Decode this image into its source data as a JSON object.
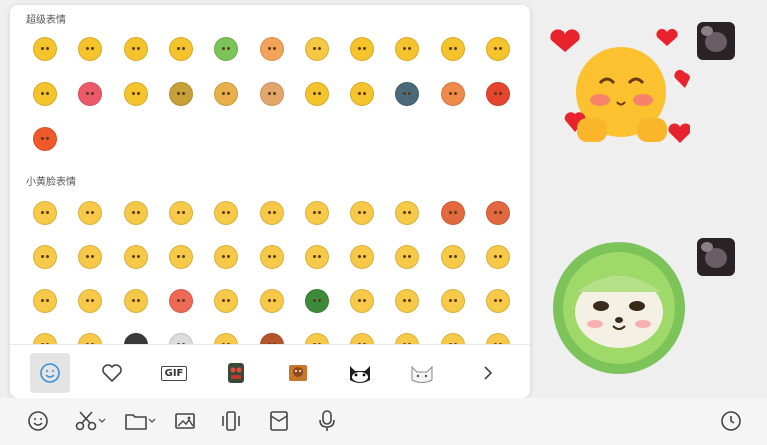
{
  "emoji_panel": {
    "sections": [
      {
        "title": "超级表情",
        "emojis": [
          {
            "name": "crying-face",
            "color": "#f5c32c"
          },
          {
            "name": "crying-laughing-face",
            "color": "#f5c32c"
          },
          {
            "name": "blushing-face",
            "color": "#f5c32c"
          },
          {
            "name": "sunglasses-face",
            "color": "#f5c32c"
          },
          {
            "name": "cabbage-dog",
            "color": "#7cc35a"
          },
          {
            "name": "eyes-pleading-face",
            "color": "#f3a35a"
          },
          {
            "name": "yellow-chick",
            "color": "#f7c844"
          },
          {
            "name": "party-face",
            "color": "#f5c32c"
          },
          {
            "name": "tongue-face",
            "color": "#f5c32c"
          },
          {
            "name": "screaming-face",
            "color": "#f5c32c"
          },
          {
            "name": "party-hat-face",
            "color": "#f5c32c"
          },
          {
            "name": "drooling-face",
            "color": "#f5c32c"
          },
          {
            "name": "kiss-face",
            "color": "#ec5a6a"
          },
          {
            "name": "peeking-face",
            "color": "#f5c32c"
          },
          {
            "name": "sunflower-face",
            "color": "#c7a03a"
          },
          {
            "name": "box-face",
            "color": "#e8b04a"
          },
          {
            "name": "dog-face",
            "color": "#e2a66b"
          },
          {
            "name": "blowing-kiss-face",
            "color": "#f5c32c"
          },
          {
            "name": "shaking-hands-face",
            "color": "#f5c32c"
          },
          {
            "name": "robot-cat",
            "color": "#4a6a7a"
          },
          {
            "name": "birthday-cake",
            "color": "#f08a4a"
          },
          {
            "name": "red-envelope",
            "color": "#e5452d"
          },
          {
            "name": "firework",
            "color": "#f05a2a"
          }
        ]
      },
      {
        "title": "小黄脸表情",
        "emojis": [
          {
            "name": "smile",
            "color": "#f7c948"
          },
          {
            "name": "grimace",
            "color": "#f7c948"
          },
          {
            "name": "heart-eyes",
            "color": "#f7c948"
          },
          {
            "name": "shocked",
            "color": "#f7c948"
          },
          {
            "name": "cool",
            "color": "#f7c948"
          },
          {
            "name": "shy",
            "color": "#f7c948"
          },
          {
            "name": "dizzy",
            "color": "#f7c948"
          },
          {
            "name": "sleepy",
            "color": "#f7c948"
          },
          {
            "name": "crying",
            "color": "#f7c948"
          },
          {
            "name": "awkward",
            "color": "#e2693f"
          },
          {
            "name": "angry",
            "color": "#e2693f"
          },
          {
            "name": "laugh",
            "color": "#f7c948"
          },
          {
            "name": "grin",
            "color": "#f7c948"
          },
          {
            "name": "surprised",
            "color": "#f7c948"
          },
          {
            "name": "sad",
            "color": "#f7c948"
          },
          {
            "name": "cool-shades",
            "color": "#f7c948"
          },
          {
            "name": "tearful",
            "color": "#f7c948"
          },
          {
            "name": "crazy",
            "color": "#f7c948"
          },
          {
            "name": "tears-of-joy",
            "color": "#f7c948"
          },
          {
            "name": "giggle",
            "color": "#f7c948"
          },
          {
            "name": "cute",
            "color": "#f7c948"
          },
          {
            "name": "proud",
            "color": "#f7c948"
          },
          {
            "name": "doubt",
            "color": "#f7c948"
          },
          {
            "name": "dumb",
            "color": "#f7c948"
          },
          {
            "name": "smug",
            "color": "#f7c948"
          },
          {
            "name": "furious",
            "color": "#ee6a55"
          },
          {
            "name": "sweat",
            "color": "#f7c948"
          },
          {
            "name": "happy",
            "color": "#f7c948"
          },
          {
            "name": "army-helmet",
            "color": "#3d8a3a"
          },
          {
            "name": "headband",
            "color": "#f7c948"
          },
          {
            "name": "yell",
            "color": "#f7c948"
          },
          {
            "name": "question",
            "color": "#f7c948"
          },
          {
            "name": "shh",
            "color": "#f7c948"
          },
          {
            "name": "partial-1",
            "color": "#f7c948"
          },
          {
            "name": "partial-2",
            "color": "#f7c948"
          },
          {
            "name": "partial-3",
            "color": "#3a3a3a"
          },
          {
            "name": "partial-4",
            "color": "#dcdcdc"
          },
          {
            "name": "partial-5",
            "color": "#f7c948"
          },
          {
            "name": "partial-6",
            "color": "#b5562a"
          },
          {
            "name": "partial-7",
            "color": "#f7c948"
          },
          {
            "name": "partial-8",
            "color": "#f7c948"
          },
          {
            "name": "partial-9",
            "color": "#f7c948"
          },
          {
            "name": "partial-10",
            "color": "#f7c948"
          },
          {
            "name": "partial-11",
            "color": "#f7c948"
          }
        ]
      }
    ],
    "tabs": [
      {
        "name": "smiley-tab",
        "icon": "smiley-icon",
        "active": true
      },
      {
        "name": "favorites-tab",
        "icon": "heart-icon",
        "active": false
      },
      {
        "name": "gif-tab",
        "icon": "gif-icon",
        "label": "GIF",
        "active": false
      },
      {
        "name": "sticker-pack-1-tab",
        "icon": "robot-sticker-icon",
        "active": false
      },
      {
        "name": "sticker-pack-2-tab",
        "icon": "bear-sticker-icon",
        "active": false
      },
      {
        "name": "sticker-pack-3-tab",
        "icon": "black-cat-sticker-icon",
        "active": false
      },
      {
        "name": "sticker-pack-4-tab",
        "icon": "white-cat-sticker-icon",
        "active": false
      },
      {
        "name": "more-tabs",
        "icon": "chevron-right-icon",
        "active": false
      }
    ]
  },
  "chat": {
    "messages": [
      {
        "sender": "self",
        "sticker": "hearts-blushing-face-sticker"
      },
      {
        "sender": "self",
        "sticker": "cabbage-dog-sticker"
      }
    ]
  },
  "toolbar": {
    "tools": [
      {
        "name": "emoji-button",
        "icon": "smiley-icon"
      },
      {
        "name": "screenshot-button",
        "icon": "scissors-icon",
        "dropdown": true
      },
      {
        "name": "file-button",
        "icon": "folder-icon",
        "dropdown": true
      },
      {
        "name": "image-button",
        "icon": "image-icon"
      },
      {
        "name": "shake-button",
        "icon": "vibrate-icon"
      },
      {
        "name": "red-packet-button",
        "icon": "red-packet-icon"
      },
      {
        "name": "voice-button",
        "icon": "microphone-icon"
      },
      {
        "name": "history-button",
        "icon": "clock-icon"
      }
    ]
  },
  "colors": {
    "panel_bg": "#ffffff",
    "page_bg": "#efefef",
    "active_tab": "#e4e4e4",
    "icon": "#444444"
  }
}
